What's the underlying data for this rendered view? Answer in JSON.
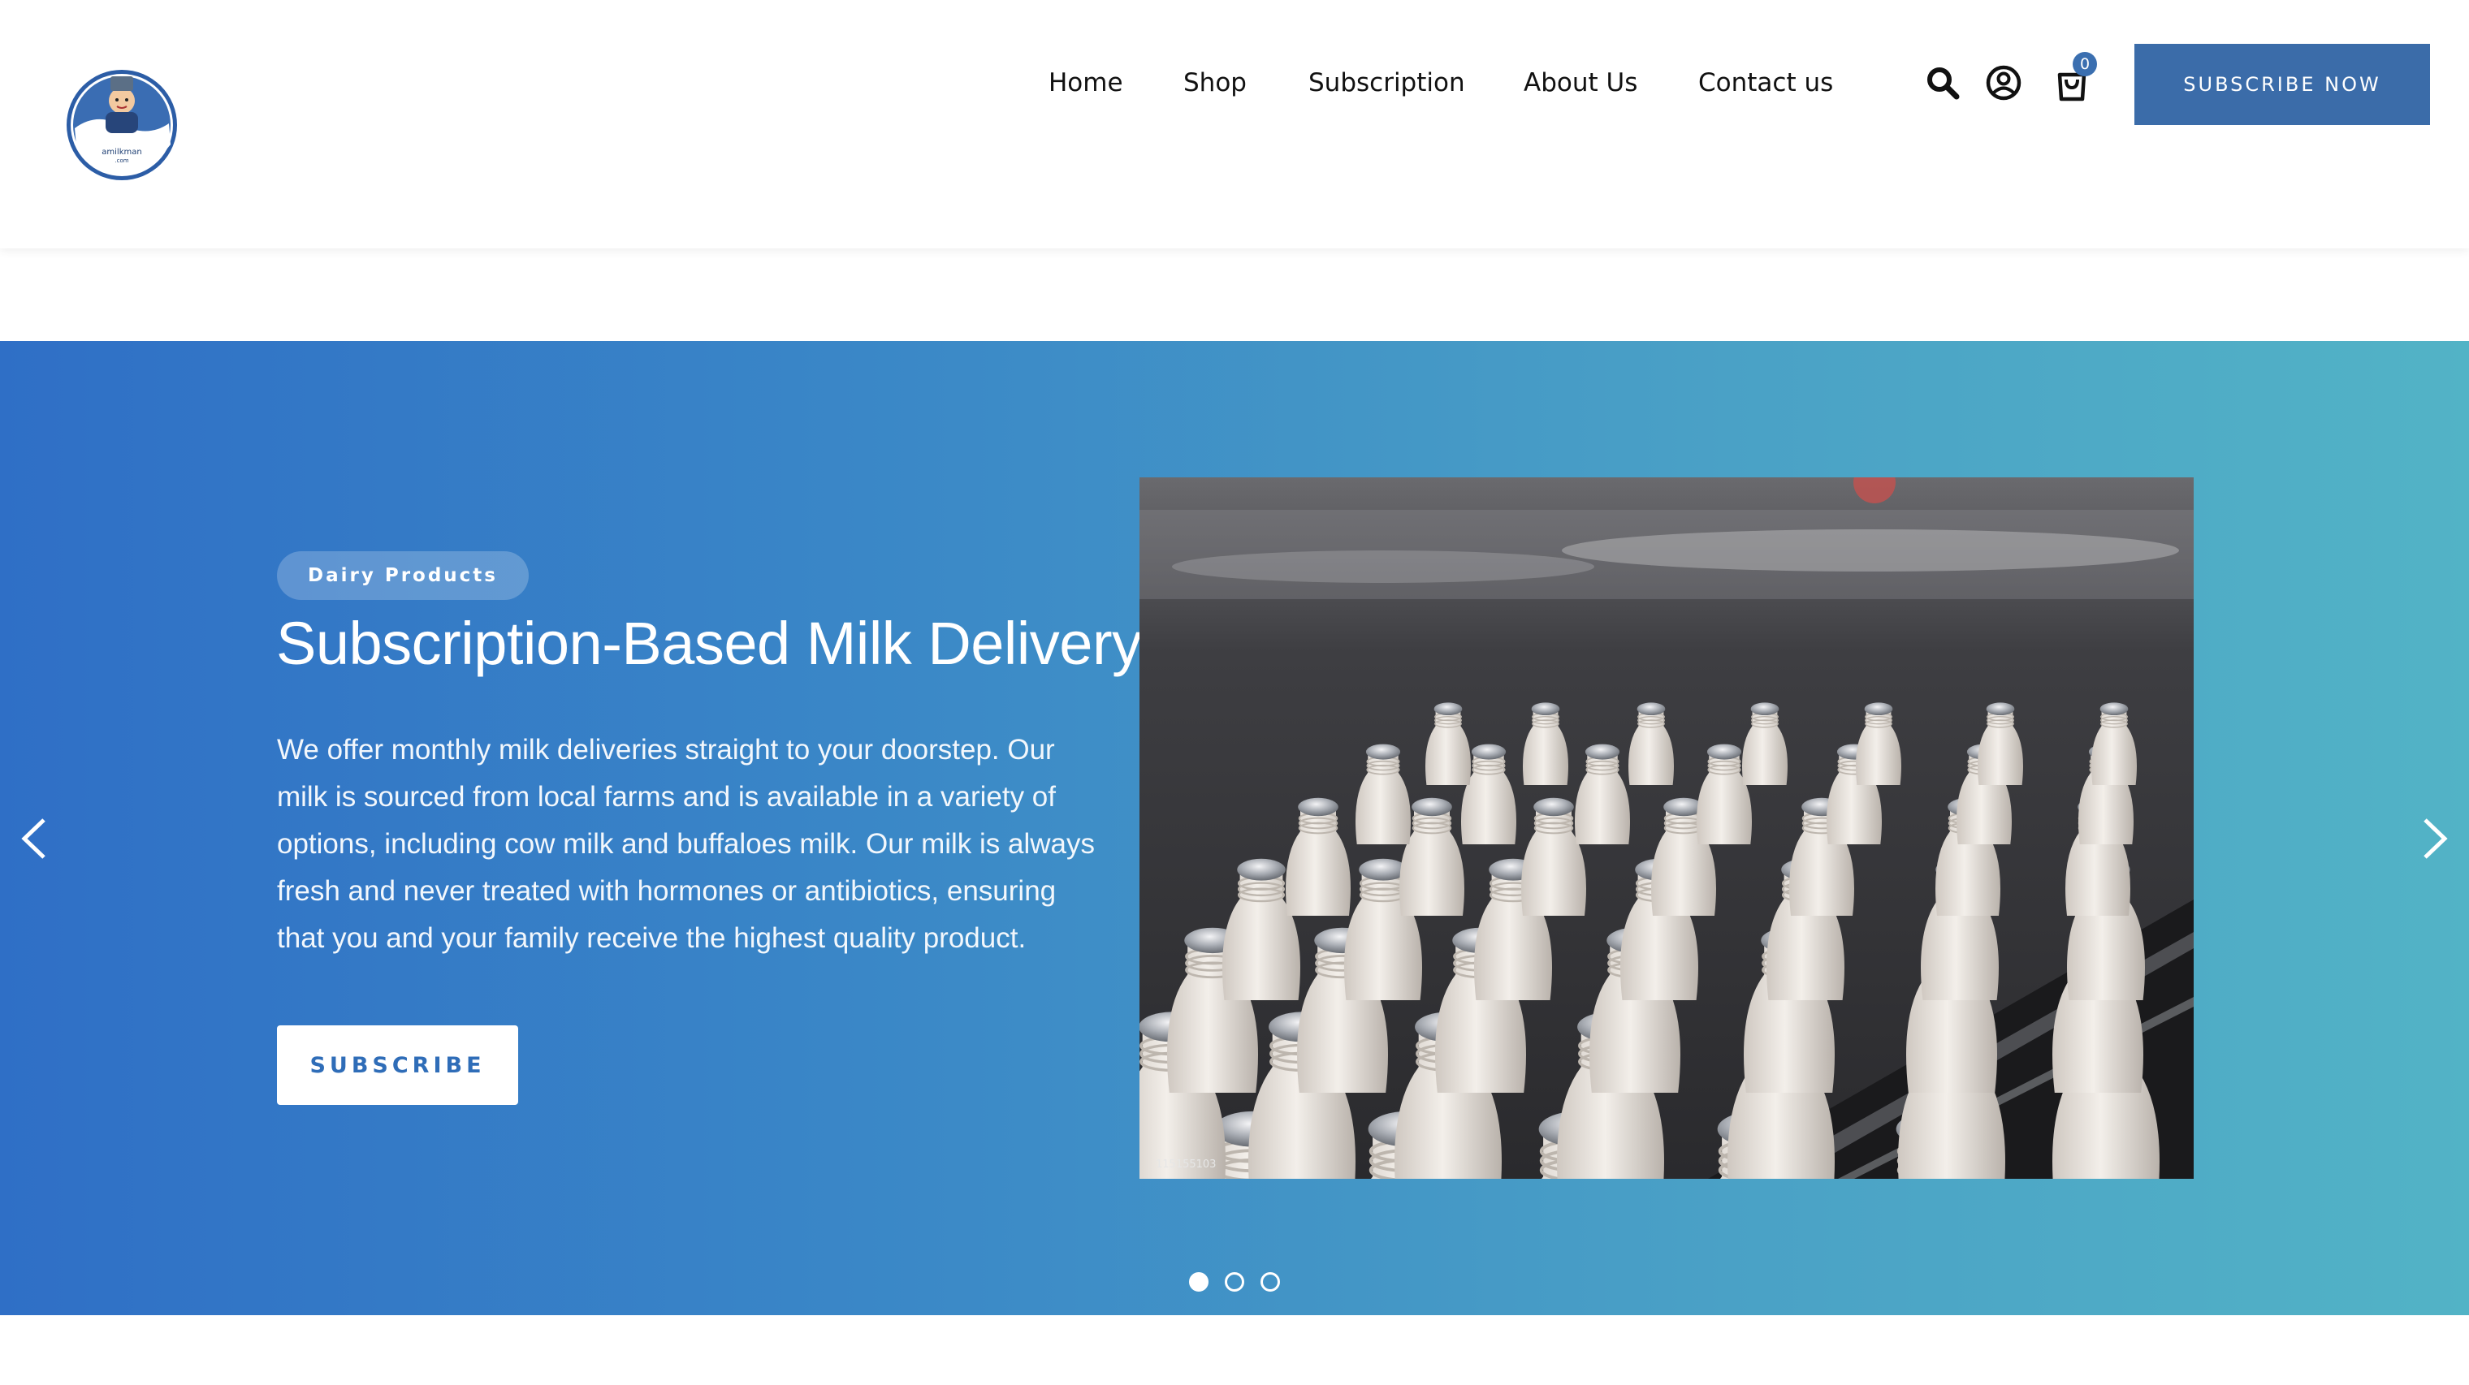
{
  "brand": {
    "logo_text": "amilkman",
    "logo_subtext": ".com",
    "logo_icon": "milkman-mascot-logo"
  },
  "nav": {
    "items": [
      {
        "label": "Home"
      },
      {
        "label": "Shop"
      },
      {
        "label": "Subscription"
      },
      {
        "label": "About Us"
      },
      {
        "label": "Contact us"
      }
    ]
  },
  "header_icons": {
    "search": "search-icon",
    "account": "user-account-icon",
    "cart": "shopping-bag-icon",
    "cart_count": "0"
  },
  "header_cta": {
    "label": "SUBSCRIBE NOW"
  },
  "hero": {
    "tag": "Dairy Products",
    "title": "Subscription-Based Milk Delivery",
    "description": "We offer monthly milk deliveries straight to your doorstep. Our milk is sourced from local farms and is available in a variety of options, including cow milk and buffaloes milk. Our milk is always fresh and never treated with hormones or antibiotics, ensuring that you and your family receive the highest quality product.",
    "button_label": "SUBSCRIBE",
    "image_id_text": "115155103",
    "slide_count": 3,
    "active_slide": 1
  },
  "colors": {
    "accent": "#3b6ca9",
    "hero_gradient_start": "#2f6fc6",
    "hero_gradient_end": "#52b3c6",
    "badge": "#3b6fb0"
  }
}
